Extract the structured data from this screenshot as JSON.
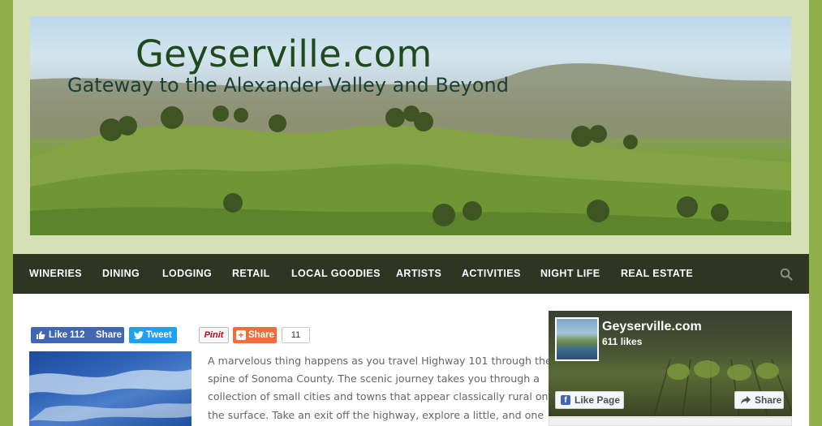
{
  "header": {
    "site_title": "Geyserville.com",
    "tagline": "Gateway to the Alexander Valley and Beyond"
  },
  "nav": {
    "items": [
      {
        "label": "WINERIES"
      },
      {
        "label": "DINING"
      },
      {
        "label": "LODGING"
      },
      {
        "label": "RETAIL"
      },
      {
        "label": "LOCAL GOODIES"
      },
      {
        "label": "ARTISTS"
      },
      {
        "label": "ACTIVITIES"
      },
      {
        "label": "NIGHT LIFE"
      },
      {
        "label": "REAL ESTATE"
      }
    ],
    "search_icon": "search-icon"
  },
  "social": {
    "fb_like_label": "Like",
    "fb_like_count": "112",
    "fb_share_label": "Share",
    "tweet_label": "Tweet",
    "pinit_label": "Pinit",
    "share_label": "Share",
    "share_count": "11"
  },
  "article": {
    "lines": [
      "A marvelous thing happens as you travel Highway 101 through the",
      "spine of Sonoma County. The scenic journey takes you through a",
      "collection of small cities and towns that appear classically rural on",
      "the surface. Take an exit off the highway, explore a little, and one"
    ]
  },
  "fb_widget": {
    "page_name": "Geyserville.com",
    "likes": "611 likes",
    "like_page_label": "Like Page",
    "share_label": "Share"
  },
  "colors": {
    "outer_bg": "#8fb04a",
    "header_bg": "#d6e0b4",
    "nav_bg": "#2e3522",
    "title": "#1f4a1d",
    "facebook": "#4267b2",
    "twitter": "#1da1f2",
    "share_orange": "#f26b3a"
  }
}
